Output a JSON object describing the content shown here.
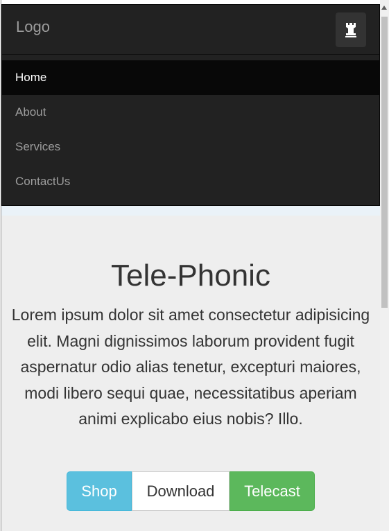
{
  "navbar": {
    "brand": "Logo",
    "toggle_icon": "chess-rook-icon",
    "items": [
      {
        "label": "Home",
        "active": true
      },
      {
        "label": "About",
        "active": false
      },
      {
        "label": "Services",
        "active": false
      },
      {
        "label": "ContactUs",
        "active": false
      }
    ]
  },
  "jumbotron": {
    "title": "Tele-Phonic",
    "description": "Lorem ipsum dolor sit amet consectetur adipisicing elit. Magni dignissimos laborum provident fugit aspernatur odio alias tenetur, excepturi maiores, modi libero sequi quae, necessitatibus aperiam animi explicabo eius nobis? Illo.",
    "buttons": {
      "shop": "Shop",
      "download": "Download",
      "telecast": "Telecast"
    }
  },
  "colors": {
    "navbar_bg": "#222222",
    "active_bg": "#080808",
    "info": "#5bc0de",
    "success": "#5cb85c",
    "jumbotron_bg": "#eeeeee"
  }
}
